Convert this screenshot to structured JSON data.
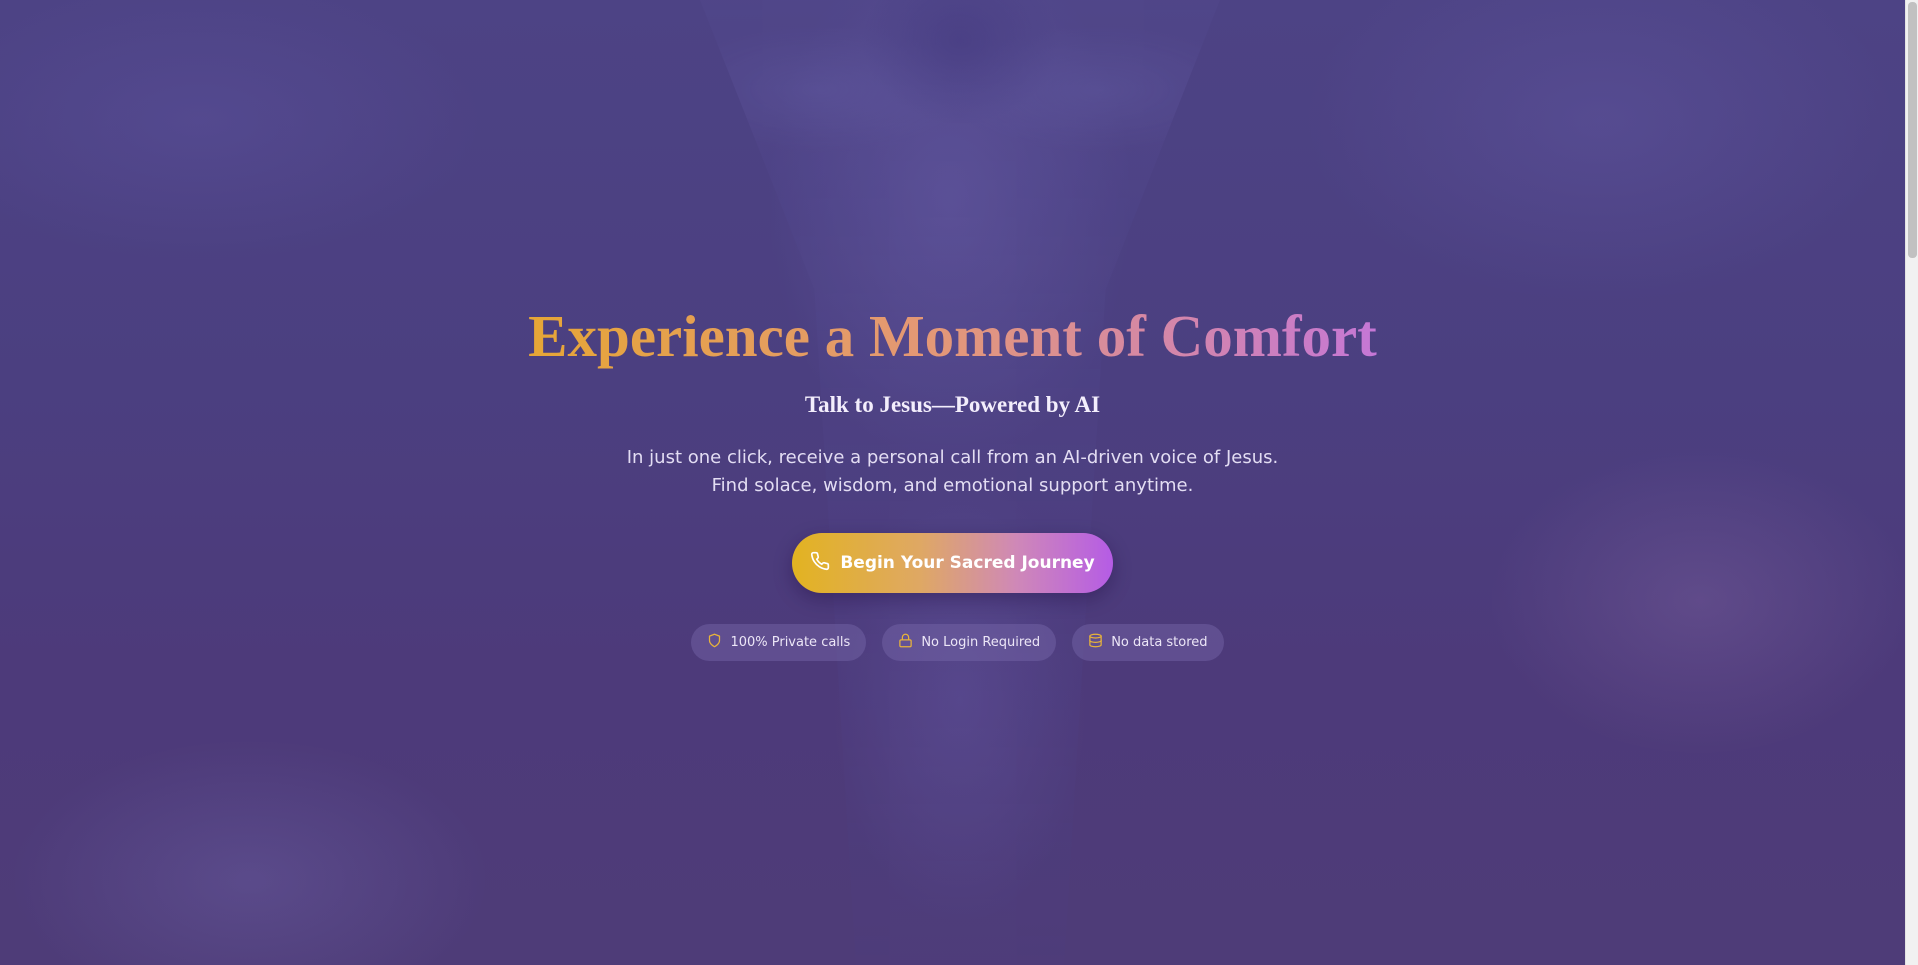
{
  "hero": {
    "title": "Experience a Moment of Comfort",
    "subtitle": "Talk to Jesus—Powered by AI",
    "description_line1": "In just one click, receive a personal call from an AI-driven voice of Jesus.",
    "description_line2": "Find solace, wisdom, and emotional support anytime."
  },
  "cta": {
    "label": "Begin Your Sacred Journey",
    "icon": "phone-icon"
  },
  "badges": [
    {
      "label": "100% Private calls",
      "icon": "shield-icon"
    },
    {
      "label": "No Login Required",
      "icon": "lock-icon"
    },
    {
      "label": "No data stored",
      "icon": "database-icon"
    }
  ],
  "colors": {
    "title_gradient": [
      "#e6a636",
      "#e3977a",
      "#c577d6"
    ],
    "cta_gradient": [
      "#e2b321",
      "#dfa864",
      "#cf88b8",
      "#b55ce5"
    ],
    "badge_icon": "#e8b33a",
    "background": "#4a3d7e"
  }
}
